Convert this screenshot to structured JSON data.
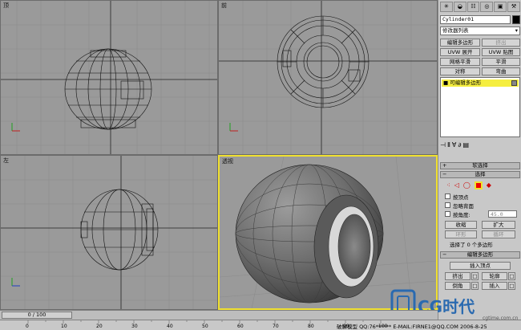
{
  "viewports": {
    "top_label": "顶",
    "front_label": "前",
    "left_label": "左",
    "persp_label": "透视"
  },
  "panel": {
    "tabs": [
      "",
      "",
      "",
      "",
      "",
      ""
    ],
    "object_name": "Cylinder01",
    "modifier_list": "修改器列表",
    "buttons": {
      "edit_poly": "编辑多边形",
      "extrude_top": "挤出",
      "uvw_unwrap": "UVW 展开",
      "uvw_map": "UVW 贴图",
      "meshsmooth": "网格平滑",
      "smooth": "平滑",
      "symmetry": "对称",
      "bend": "弯曲"
    },
    "stack_item": "可编辑多边形",
    "soft_selection": "软选择",
    "selection": "选择",
    "by_vertex": "按顶点",
    "ignore_backfacing": "忽略背面",
    "by_angle": "按角度:",
    "angle_value": "45.0",
    "shrink": "收缩",
    "grow": "扩大",
    "ring": "环形",
    "loop": "循环",
    "selected_info": "选择了 0 个多边形",
    "edit_polygons": "编辑多边形",
    "insert_vertex": "插入顶点",
    "extrude": "挤出",
    "outline": "轮廓",
    "bevel": "倒角",
    "inset": "插入"
  },
  "timeline": {
    "frame": "0 / 100",
    "ruler_ticks": [
      "0",
      "10",
      "20",
      "30",
      "40",
      "50",
      "60",
      "70",
      "80",
      "90",
      "100"
    ]
  },
  "status": {
    "text": "破解模型  QQ:76******  E-MAIL:FIRNE1@QQ.COM  2006-8-25",
    "logo": "CG时代",
    "watermark": "cgtime.com.cn"
  },
  "colors": {
    "viewport_bg": "#9a9a9a",
    "active_border": "#f0e030",
    "stack_highlight": "#f5ee40"
  }
}
